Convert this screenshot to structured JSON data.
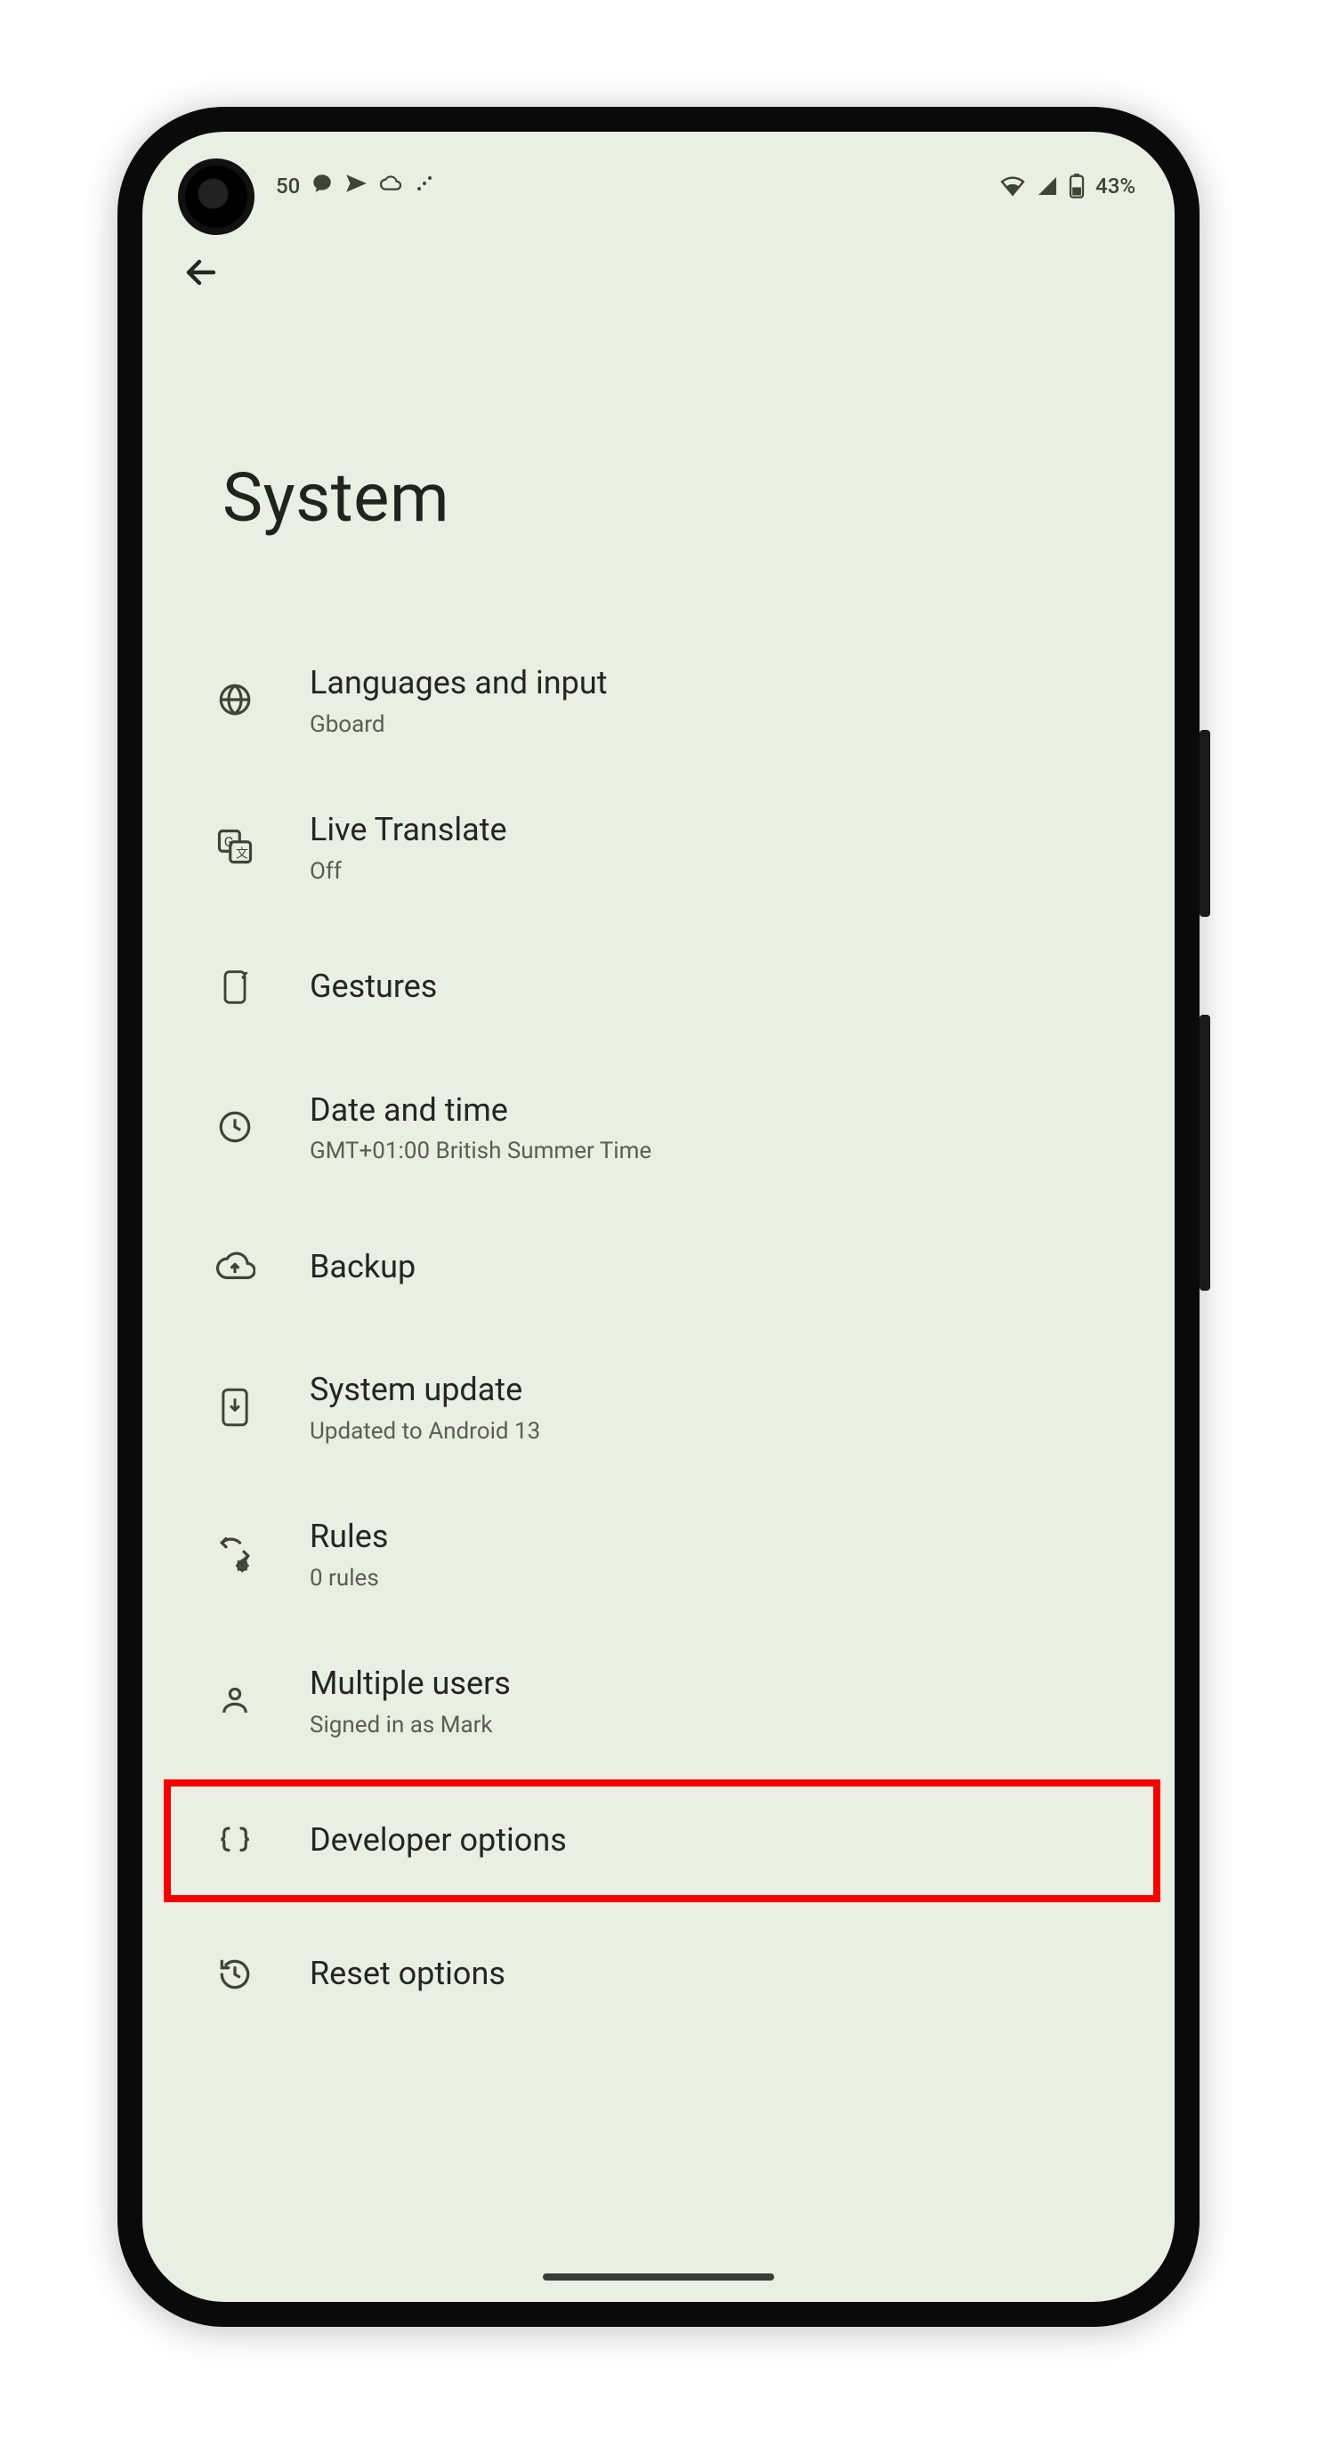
{
  "statusbar": {
    "time": "50",
    "battery_pct": "43%"
  },
  "page_title": "System",
  "items": [
    {
      "icon": "globe",
      "label": "Languages and input",
      "sub": "Gboard"
    },
    {
      "icon": "translate",
      "label": "Live Translate",
      "sub": "Off"
    },
    {
      "icon": "gesture",
      "label": "Gestures",
      "sub": ""
    },
    {
      "icon": "clock",
      "label": "Date and time",
      "sub": "GMT+01:00 British Summer Time"
    },
    {
      "icon": "cloud-up",
      "label": "Backup",
      "sub": ""
    },
    {
      "icon": "update",
      "label": "System update",
      "sub": "Updated to Android 13"
    },
    {
      "icon": "rules",
      "label": "Rules",
      "sub": "0 rules"
    },
    {
      "icon": "person",
      "label": "Multiple users",
      "sub": "Signed in as Mark"
    },
    {
      "icon": "braces",
      "label": "Developer options",
      "sub": ""
    },
    {
      "icon": "reset",
      "label": "Reset options",
      "sub": ""
    }
  ]
}
